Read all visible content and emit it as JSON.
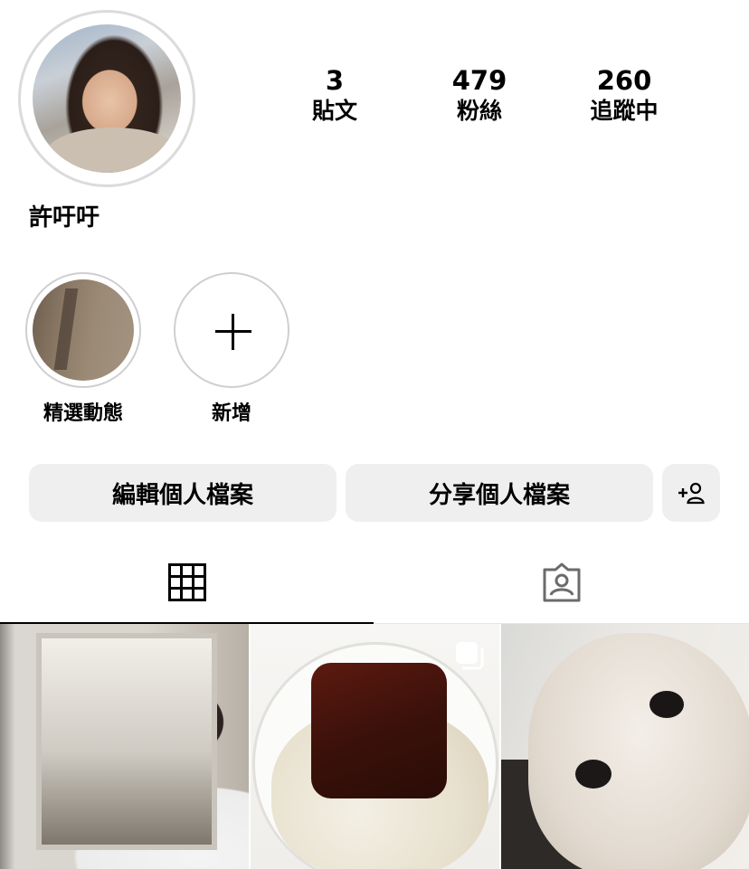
{
  "profile": {
    "username": "許吁吁",
    "stats": [
      {
        "count": "3",
        "label": "貼文"
      },
      {
        "count": "479",
        "label": "粉絲"
      },
      {
        "count": "260",
        "label": "追蹤中"
      }
    ]
  },
  "highlights": [
    {
      "label": "精選動態"
    },
    {
      "label": "新增"
    }
  ],
  "actions": {
    "edit_profile": "編輯個人檔案",
    "share_profile": "分享個人檔案",
    "add_person_icon": "person-add-icon"
  },
  "tabs": [
    {
      "icon": "grid-icon",
      "selected": true
    },
    {
      "icon": "tagged-icon",
      "selected": false
    }
  ],
  "posts": [
    {
      "type": "photo",
      "icon": "",
      "description_icon": "image"
    },
    {
      "type": "carousel",
      "icon": "multiple-posts-icon"
    },
    {
      "type": "photo",
      "icon": ""
    }
  ]
}
